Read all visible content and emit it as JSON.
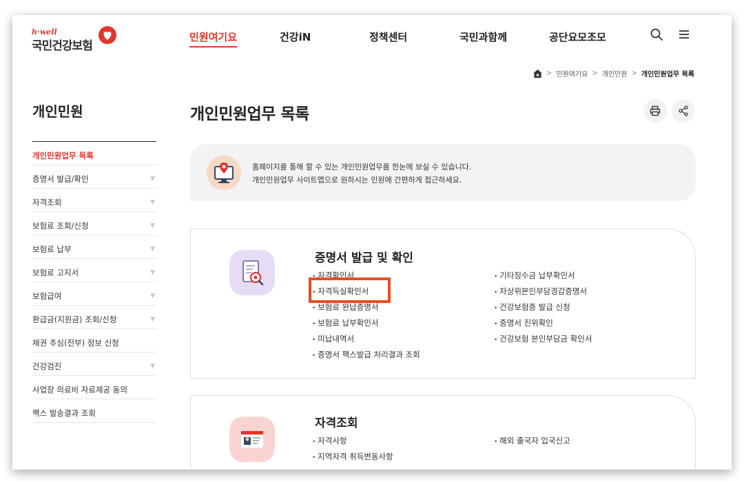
{
  "header": {
    "logo_small": "h·well",
    "logo_main": "국민건강보험",
    "nav": [
      "민원여기요",
      "건강iN",
      "정책센터",
      "국민과함께",
      "공단요모조모"
    ],
    "active_nav": "민원여기요",
    "search_icon": "search-icon",
    "menu_icon": "hamburger-menu-icon"
  },
  "breadcrumb": [
    "민원여기요",
    "개인민원",
    "개인민원업무 목록"
  ],
  "sidebar": {
    "title": "개인민원",
    "items": [
      {
        "label": "개인민원업무 목록",
        "active": true,
        "expandable": false
      },
      {
        "label": "증명서 발급/확인",
        "active": false,
        "expandable": true
      },
      {
        "label": "자격조회",
        "active": false,
        "expandable": true
      },
      {
        "label": "보험료 조회/신청",
        "active": false,
        "expandable": true
      },
      {
        "label": "보험료 납부",
        "active": false,
        "expandable": true
      },
      {
        "label": "보험료 고지서",
        "active": false,
        "expandable": true
      },
      {
        "label": "보험급여",
        "active": false,
        "expandable": true
      },
      {
        "label": "환급금(지원금) 조회/신청",
        "active": false,
        "expandable": true
      },
      {
        "label": "채권 추심(전부) 정보 신청",
        "active": false,
        "expandable": false
      },
      {
        "label": "건강검진",
        "active": false,
        "expandable": true
      },
      {
        "label": "사업장 의료비 자료제공 동의",
        "active": false,
        "expandable": false
      },
      {
        "label": "팩스 발송결과 조회",
        "active": false,
        "expandable": false
      }
    ]
  },
  "main": {
    "title": "개인민원업무 목록",
    "intro_line1": "홈페이지를 통해 할 수 있는 개인민원업무를 한눈에 보실 수 있습니다.",
    "intro_line2": "개인민원업무 사이트맵으로 원하시는 민원에 간편하게 접근하세요.",
    "sections": [
      {
        "title": "증명서 발급 및 확인",
        "left": [
          "자격확인서",
          "자격득실확인서",
          "보험료 완납증명서",
          "보험료 납부확인서",
          "미납내역서",
          "증명서 팩스발급 처리결과 조회"
        ],
        "right": [
          "기타징수금 납부확인서",
          "차상위본인부담경감증명서",
          "건강보험증 발급 신청",
          "증명서 진위확인",
          "건강보험 본인부담금 확인서"
        ]
      },
      {
        "title": "자격조회",
        "left": [
          "자격사항",
          "지역자격 취득변동사항"
        ],
        "right": [
          "해외 출국자 입국신고"
        ]
      }
    ]
  },
  "colors": {
    "accent": "#e4342d",
    "highlight": "#ea4b22",
    "card1_icon_bg": "#e7dcf5",
    "card2_icon_bg": "#fbd3d3"
  }
}
